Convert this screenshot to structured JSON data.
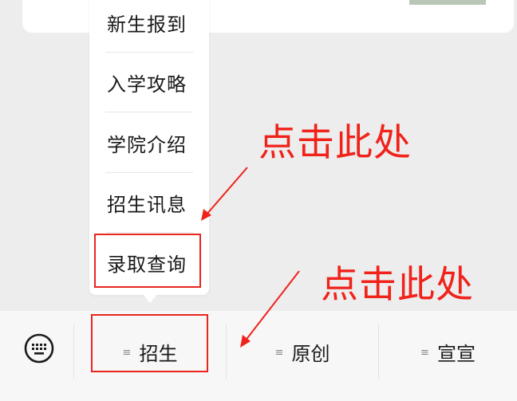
{
  "menu": {
    "items": [
      {
        "label": "新生报到"
      },
      {
        "label": "入学攻略"
      },
      {
        "label": "学院介绍"
      },
      {
        "label": "招生讯息"
      },
      {
        "label": "录取查询"
      }
    ]
  },
  "bottom_bar": {
    "tabs": [
      {
        "label": "招生",
        "lines_icon": "≡"
      },
      {
        "label": "原创",
        "lines_icon": "≡"
      },
      {
        "label": "宣宣",
        "lines_icon": "≡"
      }
    ],
    "keyboard_icon": "keyboard-icon"
  },
  "annotations": {
    "callout_1": "点击此处",
    "callout_2": "点击此处",
    "color": "#f0221a"
  }
}
